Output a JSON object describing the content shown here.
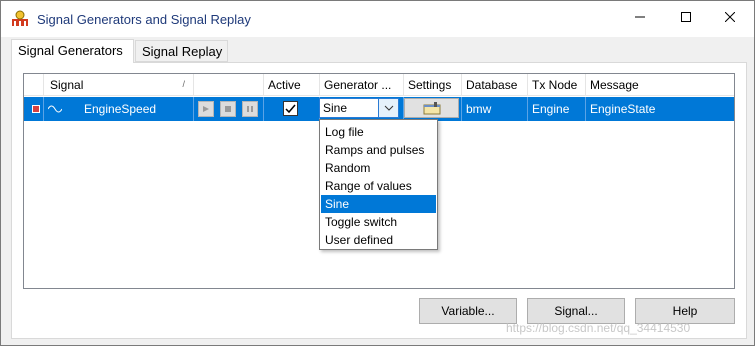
{
  "window": {
    "title": "Signal Generators and Signal Replay"
  },
  "tabs": [
    {
      "label": "Signal Generators",
      "active": true
    },
    {
      "label": "Signal Replay",
      "active": false
    }
  ],
  "grid": {
    "columns": [
      "Signal",
      "",
      "Active",
      "Generator ...",
      "Settings",
      "Database",
      "Tx Node",
      "Message"
    ],
    "rows": [
      {
        "signal": "EngineSpeed",
        "active": true,
        "generator": "Sine",
        "database": "bmw",
        "tx_node": "Engine",
        "message": "EngineState"
      }
    ]
  },
  "generator_dropdown": {
    "options": [
      "Log file",
      "Ramps and pulses",
      "Random",
      "Range of values",
      "Sine",
      "Toggle switch",
      "User defined"
    ],
    "selected": "Sine"
  },
  "buttons": {
    "variable": "Variable...",
    "signal": "Signal...",
    "help": "Help"
  },
  "watermark": "https://blog.csdn.net/qq_34414530",
  "colors": {
    "selection": "#0078d7",
    "title_text": "#1f3a7a"
  },
  "icons": {
    "app": "signal-generator-app-icon",
    "minimize": "minimize-icon",
    "maximize": "maximize-icon",
    "close": "close-icon",
    "row_marker": "red-square-icon",
    "signal": "sine-wave-icon",
    "play": "play-icon",
    "stop": "stop-icon",
    "pause": "pause-icon",
    "checkbox": "checkmark-icon",
    "combo": "chevron-down-icon",
    "settings": "settings-dialog-icon"
  }
}
